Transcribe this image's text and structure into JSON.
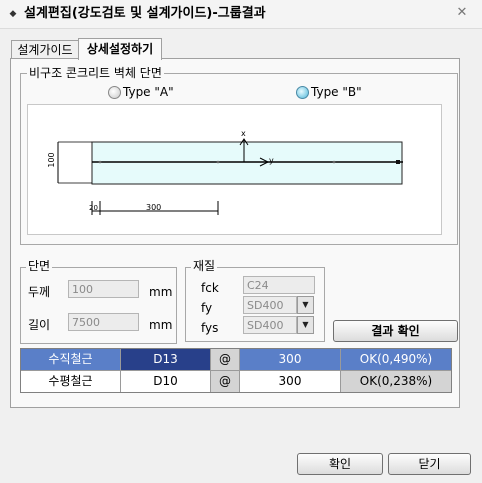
{
  "window": {
    "title": "설계편집(강도검토 및 설계가이드)-그룹결과",
    "icon": "diamond-icon",
    "close_icon": "close-icon"
  },
  "tabs": [
    {
      "label": "설계가이드",
      "active": false
    },
    {
      "label": "상세설정하기",
      "active": true
    }
  ],
  "section": {
    "legend": "비구조 콘크리트 벽체 단면",
    "type_a": {
      "label": "Type \"A\"",
      "selected": false
    },
    "type_b": {
      "label": "Type \"B\"",
      "selected": true
    }
  },
  "drawing": {
    "height_dim": "100",
    "offset_dim": "20",
    "spacing_dim": "300",
    "axis_x": "x",
    "axis_y": "y",
    "fill_color": "#e6fbfb"
  },
  "cross_section": {
    "legend": "단면",
    "thickness_label": "두께",
    "thickness_value": "100",
    "thickness_unit": "mm",
    "length_label": "길이",
    "length_value": "7500",
    "length_unit": "mm"
  },
  "material": {
    "legend": "재질",
    "fck_label": "fck",
    "fck_value": "C24",
    "fy_label": "fy",
    "fy_value": "SD400",
    "fys_label": "fys",
    "fys_value": "SD400"
  },
  "result_button": "결과 확인",
  "rebar_table": [
    {
      "name": "수직철근",
      "bar": "D13",
      "at": "@",
      "spacing": "300",
      "status": "OK(0,490%)",
      "highlighted": true
    },
    {
      "name": "수평철근",
      "bar": "D10",
      "at": "@",
      "spacing": "300",
      "status": "OK(0,238%)",
      "highlighted": false
    }
  ],
  "footer": {
    "ok_label": "확인",
    "close_label": "닫기"
  },
  "colors": {
    "highlight_row": "#5a7fc8",
    "highlight_bar_cell": "#28408a",
    "status_cell": "#d4d4d4"
  }
}
